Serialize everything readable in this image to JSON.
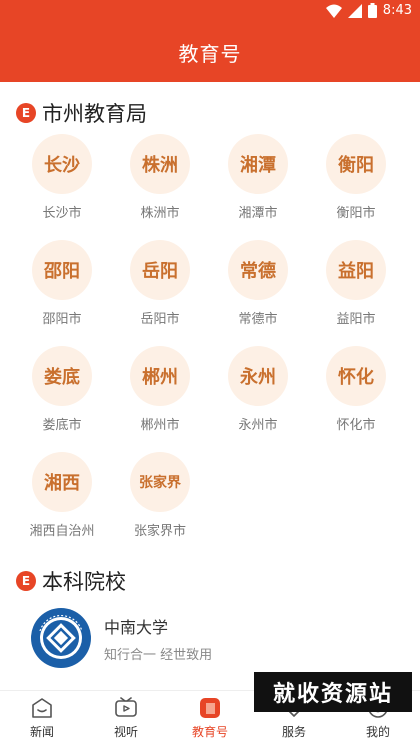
{
  "status": {
    "time": "8:43"
  },
  "header": {
    "title": "教育号"
  },
  "sections": {
    "city": {
      "badge": "E",
      "title": "市州教育局"
    },
    "univ": {
      "badge": "E",
      "title": "本科院校"
    }
  },
  "cities": [
    {
      "short": "长沙",
      "label": "长沙市"
    },
    {
      "short": "株洲",
      "label": "株洲市"
    },
    {
      "short": "湘潭",
      "label": "湘潭市"
    },
    {
      "short": "衡阳",
      "label": "衡阳市"
    },
    {
      "short": "邵阳",
      "label": "邵阳市"
    },
    {
      "short": "岳阳",
      "label": "岳阳市"
    },
    {
      "short": "常德",
      "label": "常德市"
    },
    {
      "short": "益阳",
      "label": "益阳市"
    },
    {
      "short": "娄底",
      "label": "娄底市"
    },
    {
      "short": "郴州",
      "label": "郴州市"
    },
    {
      "short": "永州",
      "label": "永州市"
    },
    {
      "short": "怀化",
      "label": "怀化市"
    },
    {
      "short": "湘西",
      "label": "湘西自治州"
    },
    {
      "short": "张家界",
      "label": "张家界市"
    }
  ],
  "university": {
    "name": "中南大学",
    "motto": "知行合一  经世致用",
    "logo_text": "CENTRAL SOUTH UNIVERSITY"
  },
  "nav": [
    {
      "label": "新闻",
      "icon": "news-icon",
      "active": false
    },
    {
      "label": "视听",
      "icon": "video-icon",
      "active": false
    },
    {
      "label": "教育号",
      "icon": "edu-icon",
      "active": true
    },
    {
      "label": "服务",
      "icon": "service-icon",
      "active": false
    },
    {
      "label": "我的",
      "icon": "profile-icon",
      "active": false
    }
  ],
  "watermark": "就收资源站",
  "colors": {
    "brand": "#e74526",
    "city_circle": "#fdf0e5",
    "city_text": "#c9702e"
  }
}
